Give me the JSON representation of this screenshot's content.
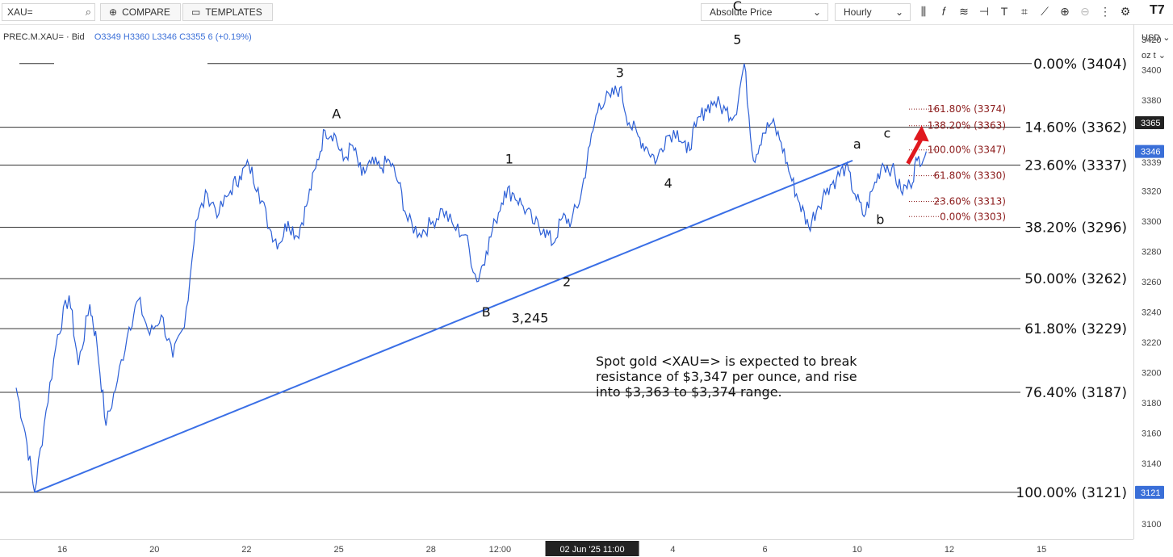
{
  "toolbar": {
    "search_value": "XAU=",
    "compare_label": "COMPARE",
    "templates_label": "TEMPLATES",
    "price_mode": "Absolute Price",
    "interval": "Hourly",
    "logo": "T7"
  },
  "legend": {
    "symbol": "PREC.M.XAU=",
    "side": "Bid",
    "open": "O3349",
    "high": "H3360",
    "low": "L3346",
    "close": "C3355",
    "change": "6 (+0.19%)"
  },
  "currency": {
    "ccy": "USD",
    "unit": "oz t"
  },
  "note": {
    "lines": [
      "Spot gold <XAU=> is expected to break",
      "resistance of $3,347 per ounce, and rise",
      "into $3,363 to $3,374 range."
    ]
  },
  "chart_data": {
    "type": "line",
    "series": [],
    "ylim": [
      3090,
      3430
    ],
    "yticks": [
      3100,
      3120,
      3140,
      3160,
      3180,
      3200,
      3220,
      3240,
      3260,
      3280,
      3300,
      3320,
      3339,
      3380,
      3400,
      3420
    ],
    "price_badges": [
      {
        "value": 3365,
        "label": "3365",
        "color": "#222222"
      },
      {
        "value": 3346,
        "label": "3346",
        "color": "#3a6fd8"
      },
      {
        "value": 3121,
        "label": "3121",
        "color": "#3a6fd8"
      }
    ],
    "xticks": [
      "16",
      "20",
      "22",
      "25",
      "28",
      "12:00",
      "02 Jun '25  11:00",
      "4",
      "6",
      "10",
      "12",
      "15"
    ],
    "xtick_index": [
      2,
      6,
      10,
      14,
      18,
      21,
      25,
      28.5,
      32.5,
      36.5,
      40.5,
      44.5
    ],
    "x_domain": [
      0,
      48
    ],
    "fib_major": [
      {
        "label": "0.00% (3404)",
        "value": 3404
      },
      {
        "label": "14.60% (3362)",
        "value": 3362
      },
      {
        "label": "23.60% (3337)",
        "value": 3337
      },
      {
        "label": "38.20% (3296)",
        "value": 3296
      },
      {
        "label": "50.00% (3262)",
        "value": 3262
      },
      {
        "label": "61.80% (3229)",
        "value": 3229
      },
      {
        "label": "76.40% (3187)",
        "value": 3187
      },
      {
        "label": "100.00% (3121)",
        "value": 3121
      }
    ],
    "fib_minor": [
      {
        "label": "161.80% (3374)",
        "value": 3374
      },
      {
        "label": "138.20% (3363)",
        "value": 3363
      },
      {
        "label": "100.00% (3347)",
        "value": 3347
      },
      {
        "label": "61.80% (3330)",
        "value": 3330
      },
      {
        "label": "23.60% (3313)",
        "value": 3313
      },
      {
        "label": "0.00% (3303)",
        "value": 3303
      }
    ],
    "price_path": [
      [
        0,
        3190
      ],
      [
        0.4,
        3160
      ],
      [
        0.8,
        3121
      ],
      [
        1.3,
        3175
      ],
      [
        1.8,
        3225
      ],
      [
        2.3,
        3251
      ],
      [
        2.7,
        3205
      ],
      [
        3.2,
        3245
      ],
      [
        3.5,
        3220
      ],
      [
        3.9,
        3165
      ],
      [
        4.4,
        3195
      ],
      [
        4.9,
        3230
      ],
      [
        5.3,
        3248
      ],
      [
        5.8,
        3225
      ],
      [
        6.3,
        3238
      ],
      [
        6.8,
        3210
      ],
      [
        7.3,
        3230
      ],
      [
        7.8,
        3300
      ],
      [
        8.3,
        3318
      ],
      [
        8.8,
        3305
      ],
      [
        9.3,
        3320
      ],
      [
        9.7,
        3330
      ],
      [
        10.1,
        3337
      ],
      [
        10.5,
        3322
      ],
      [
        11,
        3295
      ],
      [
        11.4,
        3285
      ],
      [
        11.8,
        3300
      ],
      [
        12.2,
        3290
      ],
      [
        12.6,
        3310
      ],
      [
        13,
        3335
      ],
      [
        13.4,
        3360
      ],
      [
        13.8,
        3358
      ],
      [
        14.2,
        3340
      ],
      [
        14.6,
        3350
      ],
      [
        15,
        3330
      ],
      [
        15.4,
        3338
      ],
      [
        15.8,
        3335
      ],
      [
        16.2,
        3340
      ],
      [
        16.6,
        3325
      ],
      [
        17,
        3300
      ],
      [
        17.5,
        3292
      ],
      [
        18,
        3298
      ],
      [
        18.5,
        3308
      ],
      [
        19,
        3296
      ],
      [
        19.5,
        3291
      ],
      [
        20,
        3260
      ],
      [
        20.4,
        3280
      ],
      [
        20.8,
        3300
      ],
      [
        21.2,
        3320
      ],
      [
        21.6,
        3318
      ],
      [
        22,
        3310
      ],
      [
        22.5,
        3298
      ],
      [
        22.9,
        3295
      ],
      [
        23.3,
        3285
      ],
      [
        23.7,
        3302
      ],
      [
        24.1,
        3300
      ],
      [
        24.5,
        3316
      ],
      [
        24.9,
        3350
      ],
      [
        25.3,
        3378
      ],
      [
        25.8,
        3382
      ],
      [
        26.2,
        3388
      ],
      [
        26.6,
        3365
      ],
      [
        27,
        3356
      ],
      [
        27.4,
        3348
      ],
      [
        27.8,
        3340
      ],
      [
        28.2,
        3356
      ],
      [
        28.7,
        3360
      ],
      [
        29.1,
        3345
      ],
      [
        29.5,
        3362
      ],
      [
        29.9,
        3374
      ],
      [
        30.3,
        3379
      ],
      [
        30.8,
        3373
      ],
      [
        31.2,
        3370
      ],
      [
        31.6,
        3404
      ],
      [
        32,
        3340
      ],
      [
        32.4,
        3358
      ],
      [
        32.8,
        3365
      ],
      [
        33.2,
        3352
      ],
      [
        33.6,
        3330
      ],
      [
        34,
        3312
      ],
      [
        34.4,
        3296
      ],
      [
        34.8,
        3310
      ],
      [
        35.2,
        3322
      ],
      [
        35.6,
        3328
      ],
      [
        36,
        3336
      ],
      [
        36.4,
        3318
      ],
      [
        36.8,
        3303
      ],
      [
        37.2,
        3322
      ],
      [
        37.6,
        3338
      ],
      [
        38,
        3335
      ],
      [
        38.4,
        3320
      ],
      [
        38.8,
        3324
      ],
      [
        39.1,
        3340
      ],
      [
        39.5,
        3346
      ]
    ],
    "trendline": [
      [
        0.8,
        3121
      ],
      [
        36.3,
        3340
      ]
    ],
    "wave_labels": [
      {
        "text": "A",
        "x": 13.9,
        "value": 3368
      },
      {
        "text": "B",
        "x": 20.4,
        "value": 3237
      },
      {
        "text": "3,245",
        "x": 22.3,
        "value": 3233
      },
      {
        "text": "1",
        "x": 21.4,
        "value": 3338
      },
      {
        "text": "2",
        "x": 23.9,
        "value": 3257
      },
      {
        "text": "3",
        "x": 26.2,
        "value": 3395
      },
      {
        "text": "4",
        "x": 28.3,
        "value": 3322
      },
      {
        "text": "C",
        "x": 31.3,
        "value": 3439
      },
      {
        "text": "5",
        "x": 31.3,
        "value": 3417
      },
      {
        "text": "a",
        "x": 36.5,
        "value": 3348
      },
      {
        "text": "b",
        "x": 37.5,
        "value": 3298
      },
      {
        "text": "c",
        "x": 37.8,
        "value": 3355
      }
    ],
    "arrow": {
      "from": [
        38.7,
        3338
      ],
      "to": [
        39.3,
        3360
      ],
      "color": "#e0181e"
    }
  }
}
